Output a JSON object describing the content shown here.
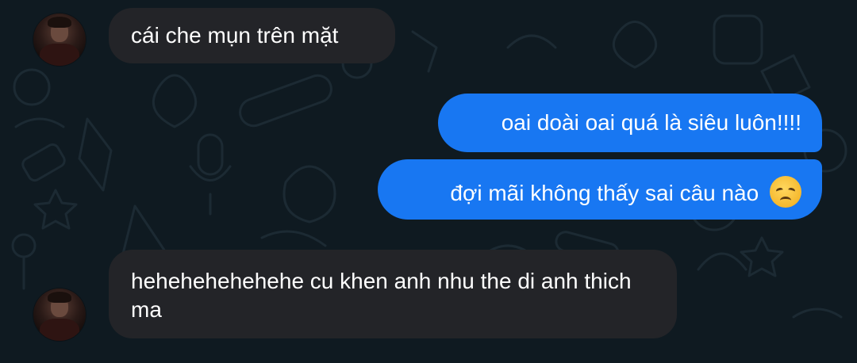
{
  "messages": [
    {
      "id": "m1",
      "direction": "incoming",
      "text": "cái che mụn trên mặt",
      "has_avatar": true
    },
    {
      "id": "m2",
      "direction": "outgoing",
      "text": "oai doài oai quá là siêu luôn!!!!"
    },
    {
      "id": "m3",
      "direction": "outgoing",
      "text": "đợi mãi không thấy sai câu nào",
      "emoji": "disappointed-face-emoji"
    },
    {
      "id": "m4",
      "direction": "incoming",
      "text": "hehehehehehehe cu khen anh nhu the di anh thich ma",
      "has_avatar": true
    }
  ],
  "colors": {
    "background": "#0f1a21",
    "incoming_bubble": "#232428",
    "outgoing_bubble": "#1877f2",
    "text": "#ffffff"
  },
  "icons": {
    "avatar": "user-avatar-photo",
    "emoji": "disappointed-face-emoji"
  }
}
